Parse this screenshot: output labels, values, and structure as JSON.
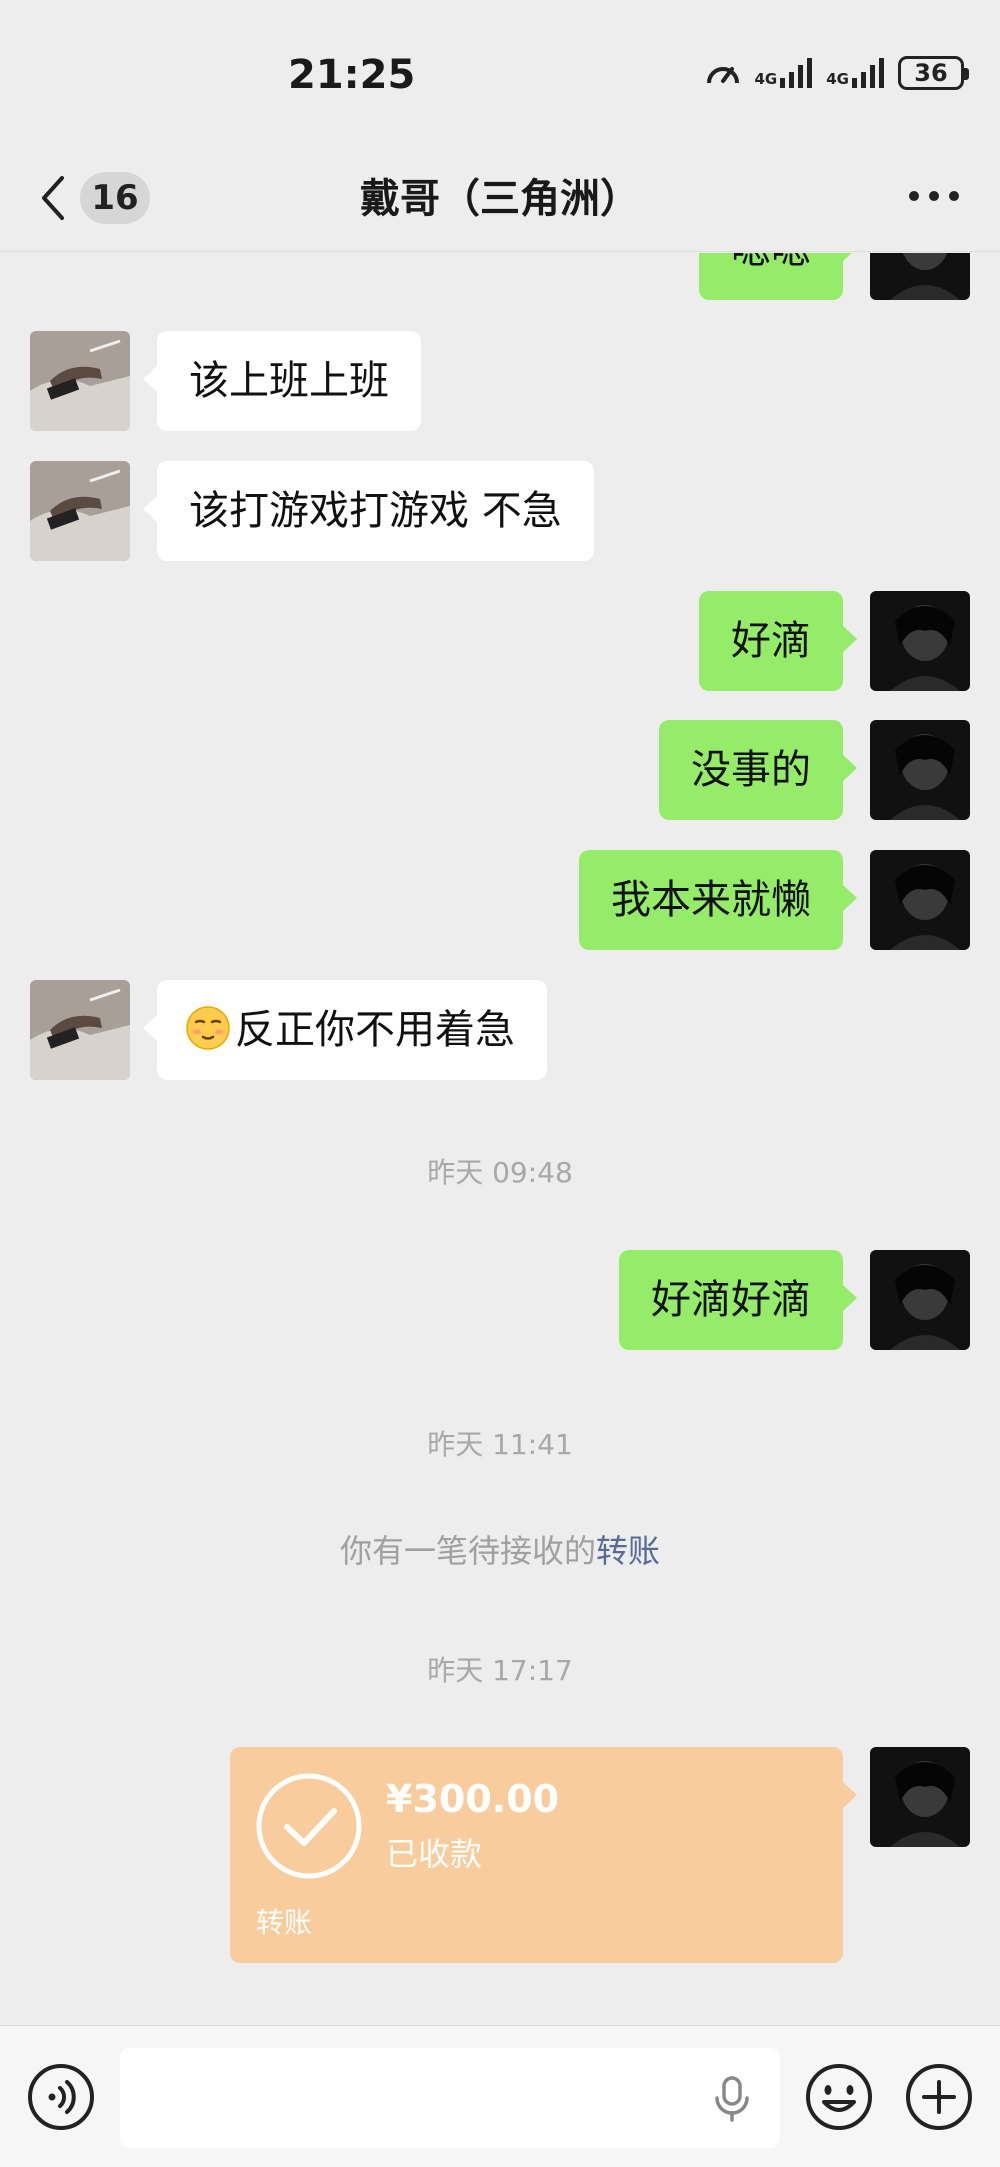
{
  "status_bar": {
    "time": "21:25",
    "network_1": "4G",
    "network_2": "4G",
    "battery": "36"
  },
  "nav": {
    "unread_count": "16",
    "title": "戴哥（三角洲）"
  },
  "messages": [
    {
      "side": "right",
      "text": "嗯嗯"
    },
    {
      "side": "left",
      "text": "该上班上班"
    },
    {
      "side": "left",
      "text": "该打游戏打游戏 不急"
    },
    {
      "side": "right",
      "text": "好滴"
    },
    {
      "side": "right",
      "text": "没事的"
    },
    {
      "side": "right",
      "text": "我本来就懒"
    },
    {
      "side": "left",
      "emoji": "smirk-face-icon",
      "text": "反正你不用着急"
    },
    {
      "side": "right",
      "text": "好滴好滴"
    }
  ],
  "timestamps": [
    "昨天 09:48",
    "昨天 11:41",
    "昨天 17:17"
  ],
  "system_note": {
    "text": "你有一笔待接收的",
    "link": "转账"
  },
  "transfer": {
    "amount": "¥300.00",
    "status": "已收款",
    "footer": "转账",
    "color": "#f9cc9d"
  },
  "input": {
    "value": "",
    "placeholder": ""
  },
  "colors": {
    "background": "#ededed",
    "bubble_self": "#95ec69",
    "bubble_other": "#ffffff",
    "link": "#576b95"
  }
}
